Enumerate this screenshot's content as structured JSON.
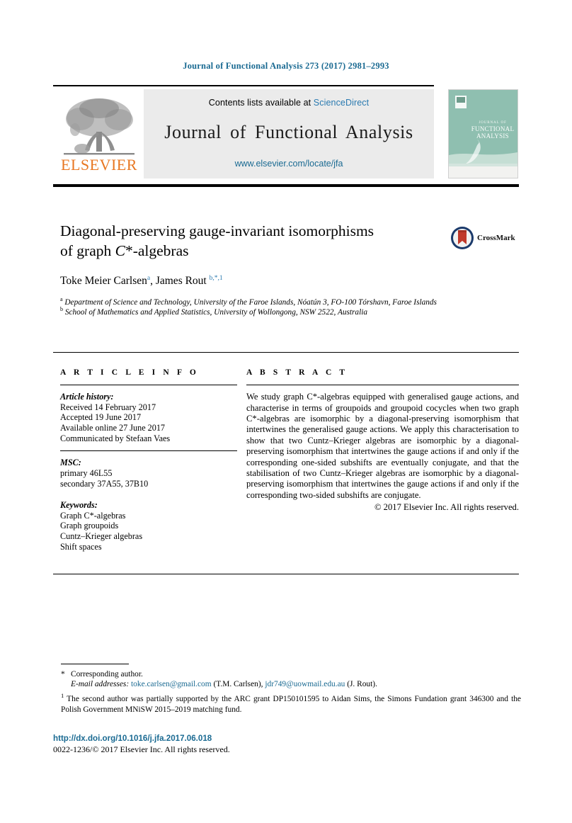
{
  "running_head": "Journal of Functional Analysis 273 (2017) 2981–2993",
  "masthead": {
    "contents_prefix": "Contents lists available at ",
    "sciencedirect": "ScienceDirect",
    "journal_name": "Journal of Functional Analysis",
    "journal_url": "www.elsevier.com/locate/jfa",
    "publisher_wordmark": "ELSEVIER",
    "cover_title_line1": "JOURNAL OF",
    "cover_title_line2": "FUNCTIONAL",
    "cover_title_line3": "ANALYSIS"
  },
  "article": {
    "title_line1": "Diagonal-preserving gauge-invariant isomorphisms",
    "title_line2_pre": "of graph ",
    "title_line2_math": "C",
    "title_line2_post": "*-algebras",
    "authors": [
      {
        "name": "Toke Meier Carlsen",
        "marks": "a"
      },
      {
        "name": "James Rout",
        "marks": "b,*,1"
      }
    ],
    "affiliations": [
      {
        "mark": "a",
        "text": "Department of Science and Technology, University of the Faroe Islands, Nóatún 3, FO-100 Tórshavn, Faroe Islands"
      },
      {
        "mark": "b",
        "text": "School of Mathematics and Applied Statistics, University of Wollongong, NSW 2522, Australia"
      }
    ]
  },
  "crossmark": {
    "label": "CrossMark"
  },
  "info": {
    "heading": "A R T I C L E   I N F O",
    "history_label": "Article history:",
    "history": [
      "Received 14 February 2017",
      "Accepted 19 June 2017",
      "Available online 27 June 2017",
      "Communicated by Stefaan Vaes"
    ],
    "msc_label": "MSC:",
    "msc": [
      "primary 46L55",
      "secondary 37A55, 37B10"
    ],
    "keywords_label": "Keywords:",
    "keywords": [
      "Graph C*-algebras",
      "Graph groupoids",
      "Cuntz–Krieger algebras",
      "Shift spaces"
    ]
  },
  "abstract": {
    "heading": "A B S T R A C T",
    "text": "We study graph C*-algebras equipped with generalised gauge actions, and characterise in terms of groupoids and groupoid cocycles when two graph C*-algebras are isomorphic by a diagonal-preserving isomorphism that intertwines the generalised gauge actions. We apply this characterisation to show that two Cuntz–Krieger algebras are isomorphic by a diagonal-preserving isomorphism that intertwines the gauge actions if and only if the corresponding one-sided subshifts are eventually conjugate, and that the stabilisation of two Cuntz–Krieger algebras are isomorphic by a diagonal-preserving isomorphism that intertwines the gauge actions if and only if the corresponding two-sided subshifts are conjugate.",
    "copyright": "© 2017 Elsevier Inc. All rights reserved."
  },
  "footnotes": {
    "corresponding_mark": "*",
    "corresponding_text": "Corresponding author.",
    "email_label": "E-mail addresses:",
    "email1": "toke.carlsen@gmail.com",
    "email1_owner": "(T.M. Carlsen),",
    "email2": "jdr749@uowmail.edu.au",
    "email2_owner": "(J. Rout).",
    "note1_mark": "1",
    "note1_text": "The second author was partially supported by the ARC grant DP150101595 to Aidan Sims, the Simons Fundation grant 346300 and the Polish Government MNiSW 2015–2019 matching fund."
  },
  "footer": {
    "doi": "http://dx.doi.org/10.1016/j.jfa.2017.06.018",
    "issn": "0022-1236/© 2017 Elsevier Inc. All rights reserved."
  },
  "colors": {
    "link_blue": "#1a6a92",
    "sciencedirect_blue": "#2a7ab0",
    "elsevier_orange": "#e87722",
    "cover_teal": "#8fbfb0",
    "crossmark_blue": "#1b3a6b",
    "crossmark_red": "#c0392b"
  }
}
